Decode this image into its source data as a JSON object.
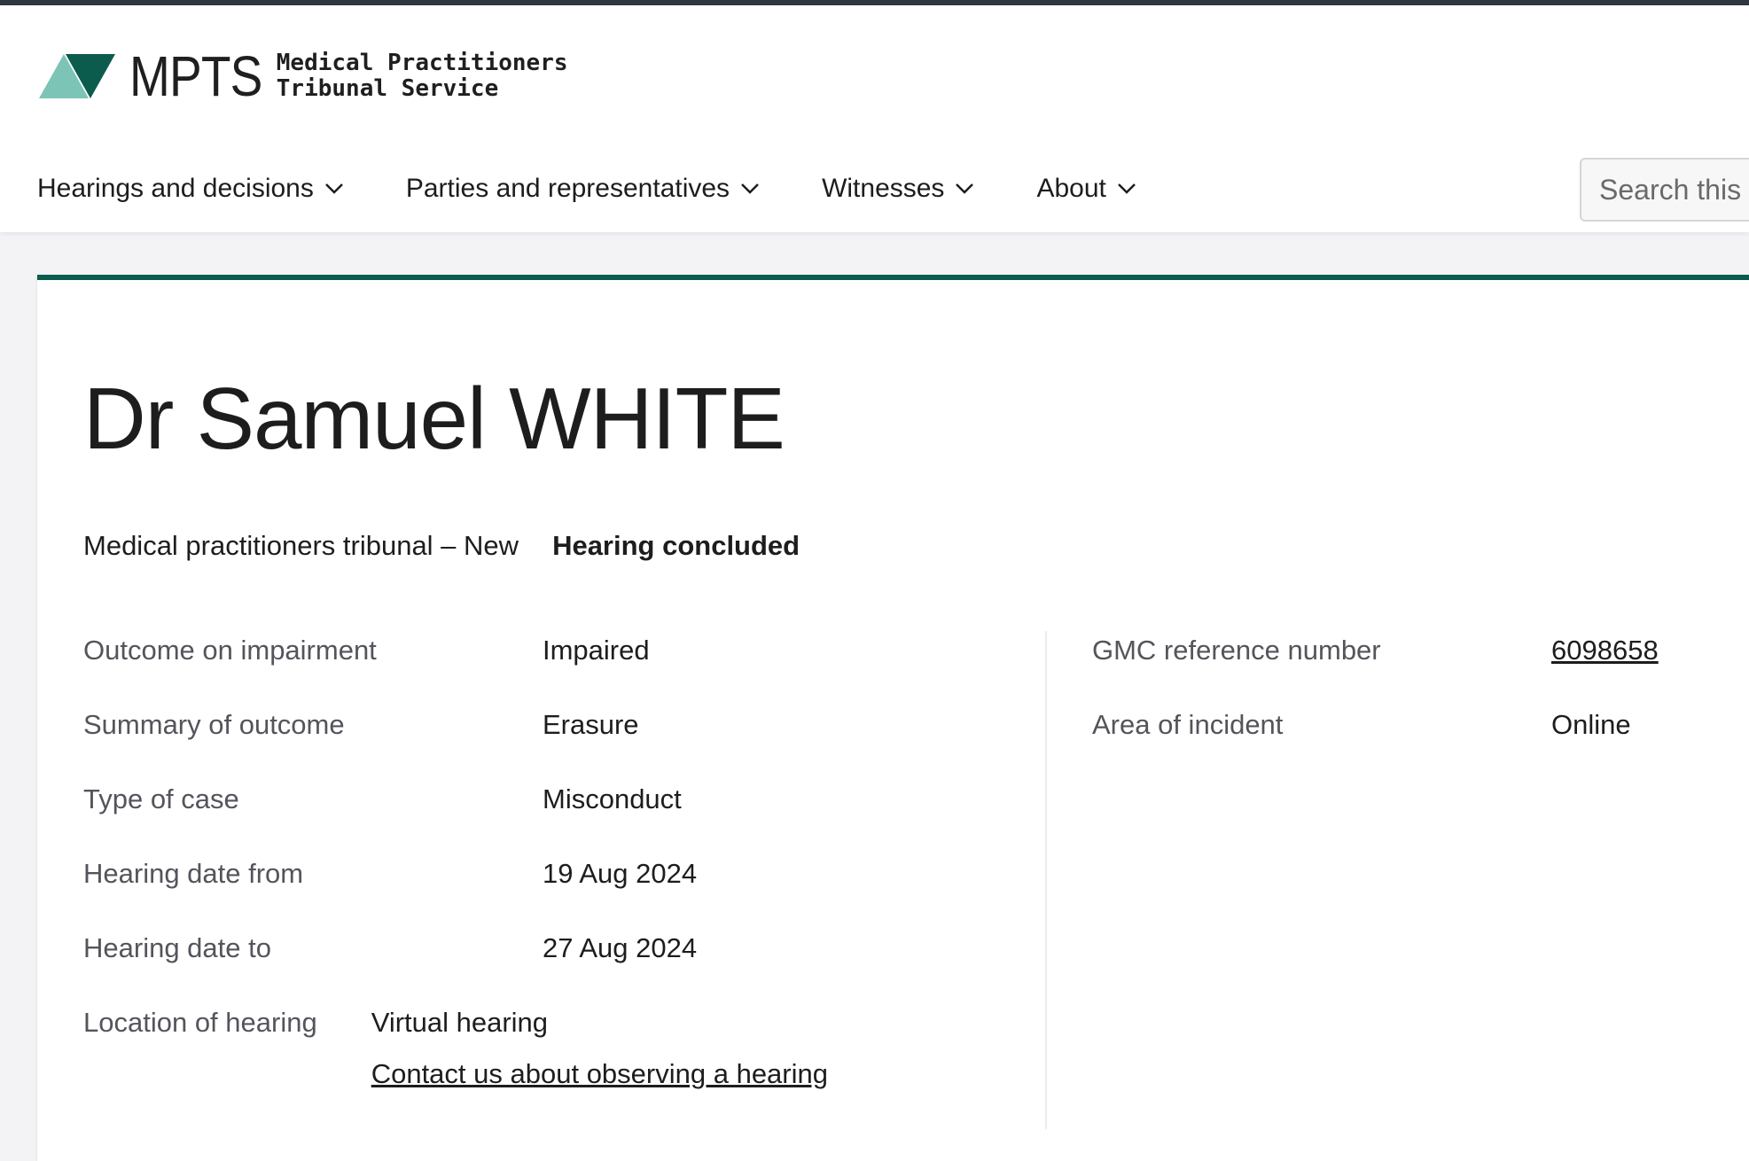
{
  "header": {
    "logo": {
      "acronym": "MPTS",
      "line1": "Medical Practitioners",
      "line2": "Tribunal Service",
      "colors": {
        "light": "#7cc4b6",
        "dark": "#0c5c4e"
      }
    },
    "nav": [
      {
        "label": "Hearings and decisions",
        "icon": "chevron-down-icon"
      },
      {
        "label": "Parties and representatives",
        "icon": "chevron-down-icon"
      },
      {
        "label": "Witnesses",
        "icon": "chevron-down-icon"
      },
      {
        "label": "About",
        "icon": "chevron-down-icon"
      }
    ],
    "search": {
      "placeholder": "Search this s"
    }
  },
  "case": {
    "name": "Dr Samuel WHITE",
    "tribunal_type": "Medical practitioners tribunal – New",
    "status": "Hearing concluded",
    "details_left": [
      {
        "label": "Outcome on impairment",
        "value": "Impaired"
      },
      {
        "label": "Summary of outcome",
        "value": "Erasure"
      },
      {
        "label": "Type of case",
        "value": "Misconduct"
      },
      {
        "label": "Hearing date from",
        "value": "19 Aug 2024"
      },
      {
        "label": "Hearing date to",
        "value": "27 Aug 2024"
      },
      {
        "label": "Location of hearing",
        "value": "Virtual hearing",
        "link": "Contact us about observing a hearing"
      }
    ],
    "details_right": [
      {
        "label": "GMC reference number",
        "value": "6098658"
      },
      {
        "label": "Area of incident",
        "value": "Online"
      }
    ]
  },
  "colors": {
    "accent": "#0c5c4e",
    "page_background": "#f3f2f5",
    "label_text": "#54545c"
  }
}
